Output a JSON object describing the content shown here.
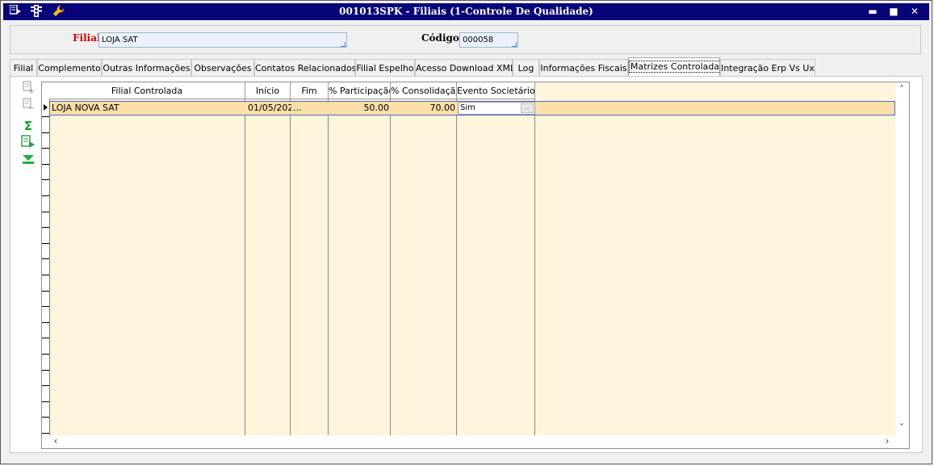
{
  "window": {
    "title": "001013SPK - Filiais (1-Controle De Qualidade)",
    "menu_icon": "menu-icon",
    "traffic_icon": "traffic-light-icon",
    "wrench_icon": "wrench-icon",
    "minimize_label": "▬",
    "maximize_label": "■",
    "close_label": "✕"
  },
  "header": {
    "filial_label": "Filial",
    "filial_value": "LOJA SAT",
    "codigo_label": "Código",
    "codigo_value": "000058",
    "filial_label_color": "#e00000"
  },
  "tabs": [
    {
      "label": "Filial"
    },
    {
      "label": "Complemento"
    },
    {
      "label": "Outras Informações"
    },
    {
      "label": "Observações"
    },
    {
      "label": "Contatos Relacionados"
    },
    {
      "label": "Filial Espelho"
    },
    {
      "label": "Acesso Download XML"
    },
    {
      "label": "Log"
    },
    {
      "label": "Informações Fiscais"
    },
    {
      "label": "Matrizes Controladas",
      "active": true
    },
    {
      "label": "Integração Erp Vs Ux"
    }
  ],
  "toolbar": {
    "icons": [
      "add-record-icon",
      "remove-record-icon",
      "sum-icon",
      "export-icon",
      "filter-icon"
    ],
    "sum_glyph": "Σ"
  },
  "grid": {
    "columns": [
      "Filial Controlada",
      "Início",
      "Fim",
      "% Participação",
      "% Consolidação",
      "Evento Societário"
    ],
    "rows": [
      {
        "filial_controlada": "LOJA NOVA SAT",
        "inicio": "01/05/202",
        "fim": "...",
        "participacao": "50.00",
        "consolidacao": "70.00",
        "evento_societario": "Sim"
      }
    ],
    "row_background": "#fbdfa8",
    "grid_background": "#fff4dc"
  }
}
